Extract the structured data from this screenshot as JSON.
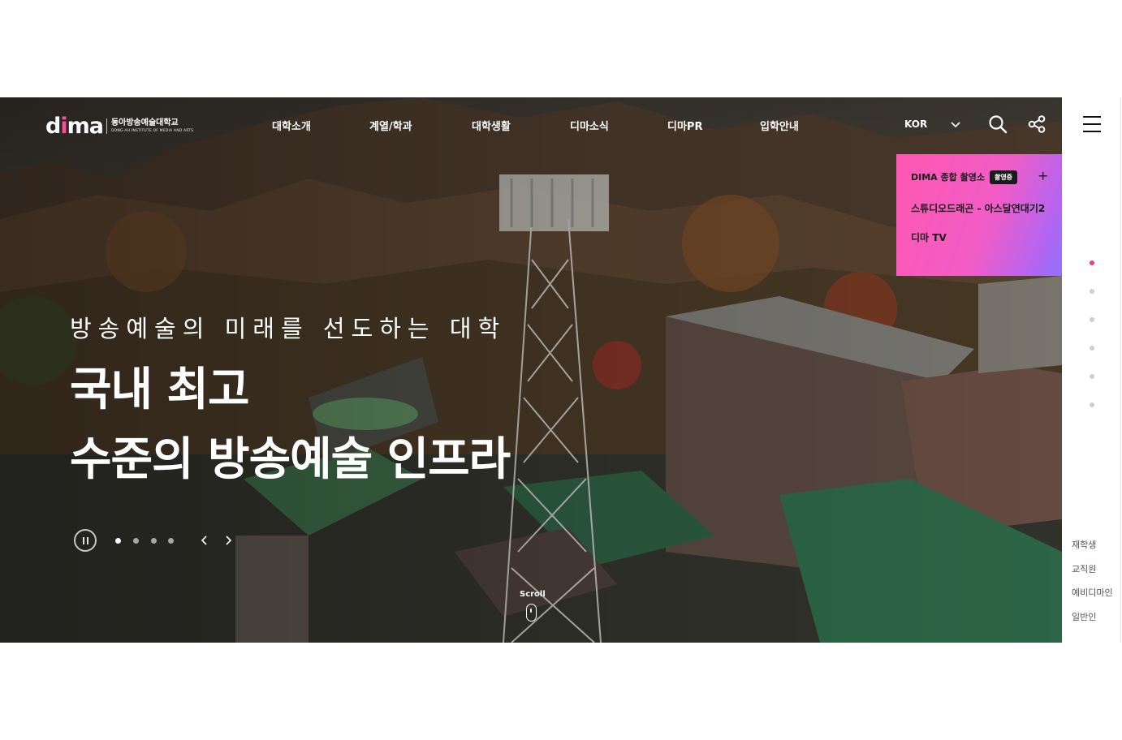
{
  "header": {
    "logo_mark": "dima",
    "logo_name_ko": "동아방송예술대학교",
    "logo_name_en": "DONG-AH INSTITUTE OF MEDIA AND ARTS",
    "nav": [
      "대학소개",
      "계열/학과",
      "대학생활",
      "디마소식",
      "디마PR",
      "입학안내"
    ],
    "language": "KOR",
    "icons": {
      "lang": "chevron-down-icon",
      "search": "search-icon",
      "share": "share-icon",
      "menu": "hamburger-menu-icon"
    }
  },
  "live_panel": {
    "title": "DIMA 종합 촬영소",
    "badge": "촬영중",
    "items": [
      "스튜디오드래곤 - 아스달연대기2",
      "디마 TV"
    ],
    "icon": "plus-icon",
    "gradient": [
      "#ff58b2",
      "#8f72ff"
    ]
  },
  "visual": {
    "sub_copy": "방송예술의 미래를 선도하는 대학",
    "main_copy_line1": "국내 최고",
    "main_copy_line2": "수준의 방송예술 인프라",
    "slide_count": 4,
    "active_slide": 1,
    "icons": {
      "pause": "pause-icon",
      "prev": "chevron-left-icon",
      "next": "chevron-right-icon"
    }
  },
  "scroll": {
    "label": "Scroll",
    "icon": "mouse-scroll-icon"
  },
  "rail": {
    "section_count": 6,
    "active_section": 1,
    "active_color": "#e83d8c",
    "quick_links": [
      "재학생",
      "교직원",
      "예비디마인",
      "일반인"
    ]
  }
}
